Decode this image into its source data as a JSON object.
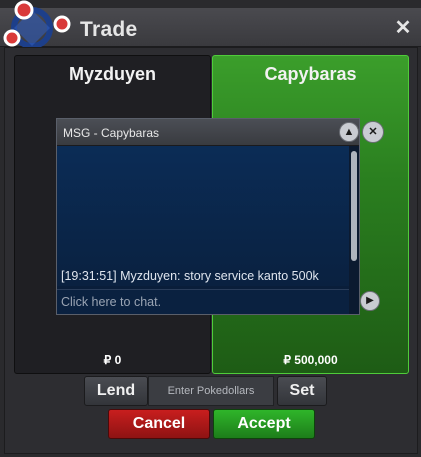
{
  "window": {
    "title": "Trade",
    "close_label": "✕"
  },
  "trade": {
    "left_player": {
      "name": "Myzduyen",
      "amount": "₽ 0"
    },
    "right_player": {
      "name": "Capybaras",
      "amount": "₽ 500,000"
    }
  },
  "chat": {
    "title": "MSG - Capybaras",
    "up_icon": "▲",
    "close_icon": "✕",
    "message": "[19:31:51] Myzduyen: story service kanto 500k",
    "input_placeholder": "Click here to chat.",
    "send_icon": "▶"
  },
  "controls": {
    "lend_label": "Lend",
    "pokedollars_placeholder": "Enter Pokedollars",
    "set_label": "Set",
    "cancel_label": "Cancel",
    "accept_label": "Accept"
  },
  "colors": {
    "accent_green": "#2a7e1f",
    "cancel_red": "#c81e1e",
    "accept_green": "#2fb52a"
  }
}
